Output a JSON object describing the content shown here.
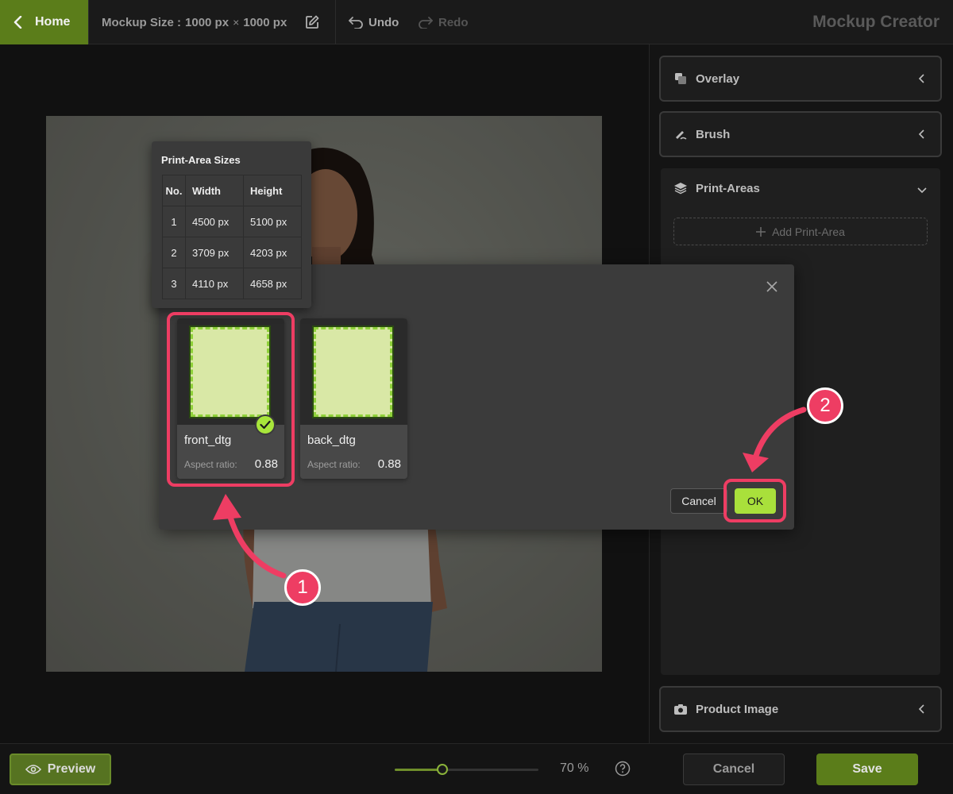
{
  "topbar": {
    "home_label": "Home",
    "mockup_size_label": "Mockup Size :",
    "mockup_width": "1000 px",
    "times": "×",
    "mockup_height": "1000 px",
    "undo_label": "Undo",
    "redo_label": "Redo",
    "app_title": "Mockup Creator"
  },
  "right_panel": {
    "overlay_label": "Overlay",
    "brush_label": "Brush",
    "print_areas_label": "Print-Areas",
    "add_print_area_label": "Add Print-Area",
    "product_image_label": "Product Image"
  },
  "bottombar": {
    "preview_label": "Preview",
    "zoom": "70 %",
    "zoom_level": 0.33,
    "cancel_label": "Cancel",
    "save_label": "Save"
  },
  "sizes_popover": {
    "title": "Print-Area Sizes",
    "headers": [
      "No.",
      "Width",
      "Height"
    ],
    "rows": [
      {
        "no": "1",
        "width": "4500 px",
        "height": "5100 px"
      },
      {
        "no": "2",
        "width": "3709 px",
        "height": "4203 px"
      },
      {
        "no": "3",
        "width": "4110 px",
        "height": "4658 px"
      }
    ]
  },
  "dialog": {
    "cards": [
      {
        "name": "front_dtg",
        "aspect_label": "Aspect ratio:",
        "aspect_value": "0.88",
        "selected": true
      },
      {
        "name": "back_dtg",
        "aspect_label": "Aspect ratio:",
        "aspect_value": "0.88",
        "selected": false
      }
    ],
    "cancel_label": "Cancel",
    "ok_label": "OK"
  },
  "annotations": {
    "step1": "1",
    "step2": "2",
    "color": "#ee3d63"
  },
  "colors": {
    "brand_green": "#5b7d1a",
    "accent_lime": "#a9e03b",
    "print_area_fill": "#d9e8a6"
  }
}
